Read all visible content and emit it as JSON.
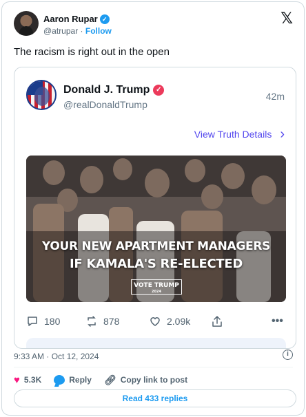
{
  "tweet": {
    "author_name": "Aaron Rupar",
    "author_handle": "@atrupar",
    "separator": "·",
    "follow_label": "Follow",
    "text": "The racism is right out in the open",
    "timestamp": "9:33 AM · Oct 12, 2024"
  },
  "embed": {
    "author_name": "Donald J. Trump",
    "author_handle": "@realDonaldTrump",
    "time": "42m",
    "view_details_label": "View Truth Details",
    "image_text_line1": "YOUR NEW APARTMENT MANAGERS",
    "image_text_line2": "IF KAMALA'S RE-ELECTED",
    "badge_text": "VOTE TRUMP",
    "badge_year": "2024",
    "actions": {
      "replies": "180",
      "retruths": "878",
      "likes": "2.09k"
    }
  },
  "engagement": {
    "likes": "5.3K",
    "reply_label": "Reply",
    "copy_link_label": "Copy link to post",
    "read_replies_label": "Read 433 replies"
  },
  "icons": {
    "x_logo": "x-logo-icon",
    "verified": "verified-badge-icon",
    "truth_verified": "truth-verified-icon",
    "chevron": "chevron-right-icon",
    "reply": "comment-icon",
    "retruth": "retruth-icon",
    "like": "heart-outline-icon",
    "share": "share-icon",
    "more": "more-icon",
    "info": "info-icon",
    "heart": "heart-filled-icon",
    "bubble": "reply-bubble-icon",
    "link": "link-icon"
  },
  "colors": {
    "twitter_blue": "#1d9bf0",
    "truth_purple": "#5448ee",
    "like_pink": "#f91880",
    "muted_text": "#536471"
  }
}
